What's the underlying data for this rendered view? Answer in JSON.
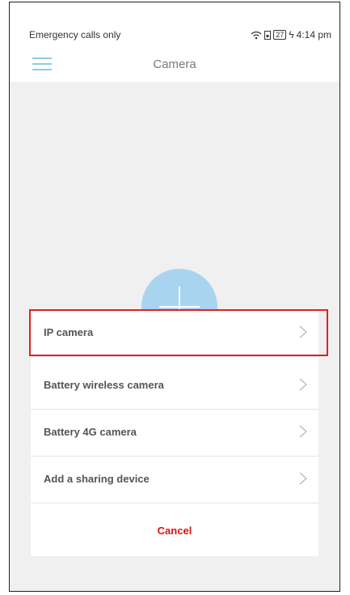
{
  "status_bar": {
    "carrier_text": "Emergency calls only",
    "battery_level": "27",
    "time": "4:14 pm"
  },
  "app_bar": {
    "title": "Camera",
    "menu_icon": "hamburger-menu-icon"
  },
  "sheet": {
    "items": [
      {
        "label": "IP camera",
        "highlighted": true
      },
      {
        "label": "Battery wireless camera"
      },
      {
        "label": "Battery 4G camera"
      },
      {
        "label": "Add a sharing device"
      }
    ],
    "cancel_label": "Cancel"
  },
  "colors": {
    "accent": "#8ccbe8",
    "add_button": "#a9d4ef",
    "cancel": "#e01010",
    "highlight_border": "#e02020"
  }
}
